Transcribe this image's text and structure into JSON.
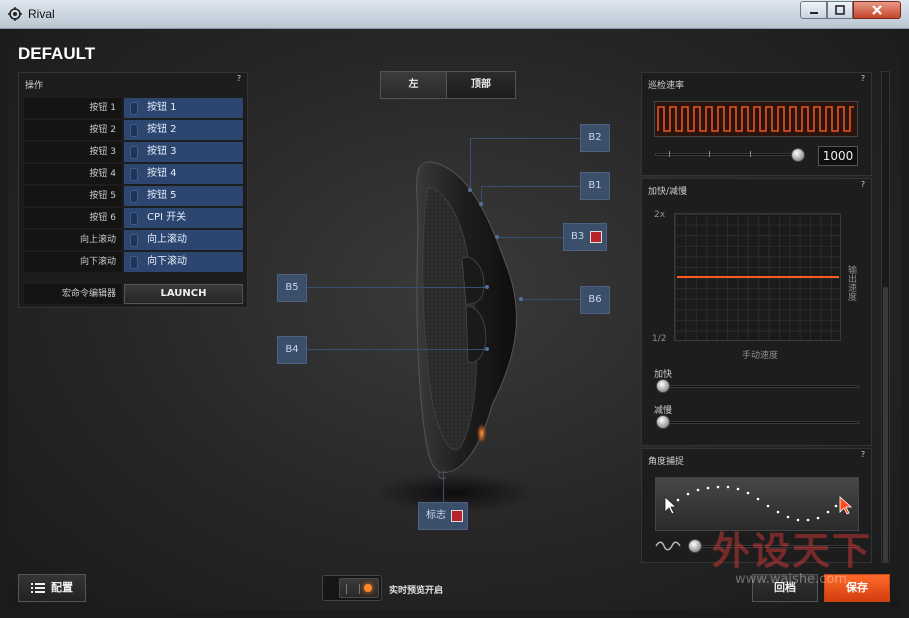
{
  "window": {
    "title": "Rival"
  },
  "profile": {
    "name": "DEFAULT"
  },
  "buttons_panel": {
    "title": "操作",
    "help": "?",
    "rows": [
      {
        "label": "按钮 1",
        "value": "按钮 1"
      },
      {
        "label": "按钮 2",
        "value": "按钮 2"
      },
      {
        "label": "按钮 3",
        "value": "按钮 3"
      },
      {
        "label": "按钮 4",
        "value": "按钮 4"
      },
      {
        "label": "按钮 5",
        "value": "按钮 5"
      },
      {
        "label": "按钮 6",
        "value": "CPI 开关"
      },
      {
        "label": "向上滚动",
        "value": "向上滚动"
      },
      {
        "label": "向下滚动",
        "value": "向下滚动"
      }
    ],
    "macro": {
      "label": "宏命令编辑器",
      "button": "LAUNCH"
    }
  },
  "view_tabs": {
    "left": "左",
    "top": "顶部",
    "active": "left"
  },
  "mouse_tags": {
    "b1": "B1",
    "b2": "B2",
    "b3": "B3",
    "b4": "B4",
    "b5": "B5",
    "b6": "B6",
    "logo": "标志",
    "b3_color": "#b8232b",
    "logo_color": "#b8232b"
  },
  "polling": {
    "title": "巡检速率",
    "help": "?",
    "value": "1000",
    "slider_level": 1.0,
    "wave_color": "#e8561e"
  },
  "accel": {
    "title": "加快/减慢",
    "help": "?",
    "y_max": "2x",
    "y_min": "1/2",
    "x_label": "手动速度",
    "y_label": "输出速度",
    "accel_label": "加快",
    "decel_label": "减慢",
    "accel_level": 0.0,
    "decel_level": 0.0,
    "line_color": "#ff5a1f"
  },
  "angle_snap": {
    "title": "角度捕捉",
    "help": "?",
    "level": 0.0
  },
  "bottom": {
    "config_label": "配置",
    "live_preview_label": "实时预览开启",
    "revert_label": "回档",
    "save_label": "保存",
    "accent": "#ff5a1f"
  },
  "watermark": {
    "text": "外设天下",
    "url": "www.waishe.com"
  }
}
